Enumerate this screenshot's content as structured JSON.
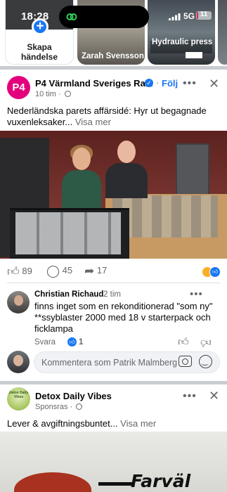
{
  "status_bar": {
    "time": "18:28",
    "network": "5G",
    "battery": "11",
    "battery_level": 0.11
  },
  "stories": {
    "create_label": "Skapa\nhändelse",
    "items": [
      {
        "name": "Zarah Svensson"
      },
      {
        "name": "Hydraulic press"
      }
    ],
    "colors": {
      "plus": "#1877f2"
    }
  },
  "post": {
    "page_name": "P4 Värmland Sveriges Ra...",
    "avatar_text": "P4",
    "follow_label": "Följ",
    "time": "10 tim",
    "text": "Nederländska parets affärsidé: Hyr ut begagnade vuxenleksaker...",
    "see_more": "Visa mer",
    "likes": "89",
    "comments": "45",
    "shares": "17",
    "colors": {
      "brand": "#e4007c",
      "link": "#1877f2"
    }
  },
  "comment": {
    "author": "Christian Richaud",
    "time": "2 tim",
    "text": "finns inget som en rekonditionerad \"som ny\" **ssyblaster 2000 med 18 v starterpack och ficklampa",
    "reply_label": "Svara",
    "like_count": "1",
    "input_placeholder": "Kommentera som Patrik Malmberg"
  },
  "ad": {
    "name": "Detox Daily Vibes",
    "avatar_text": "Detox Daily Vibes",
    "sponsored": "Sponsras",
    "text": "Lever & avgiftningsbuntet...",
    "see_more": "Visa mer",
    "headline": "Farväl"
  }
}
